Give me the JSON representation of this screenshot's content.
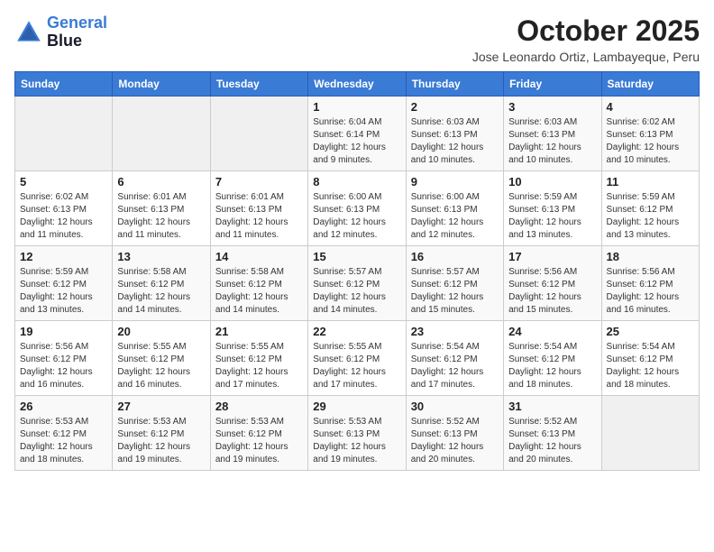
{
  "header": {
    "logo_line1": "General",
    "logo_line2": "Blue",
    "month": "October 2025",
    "location": "Jose Leonardo Ortiz, Lambayeque, Peru"
  },
  "weekdays": [
    "Sunday",
    "Monday",
    "Tuesday",
    "Wednesday",
    "Thursday",
    "Friday",
    "Saturday"
  ],
  "weeks": [
    [
      {
        "day": "",
        "info": ""
      },
      {
        "day": "",
        "info": ""
      },
      {
        "day": "",
        "info": ""
      },
      {
        "day": "1",
        "info": "Sunrise: 6:04 AM\nSunset: 6:14 PM\nDaylight: 12 hours\nand 9 minutes."
      },
      {
        "day": "2",
        "info": "Sunrise: 6:03 AM\nSunset: 6:13 PM\nDaylight: 12 hours\nand 10 minutes."
      },
      {
        "day": "3",
        "info": "Sunrise: 6:03 AM\nSunset: 6:13 PM\nDaylight: 12 hours\nand 10 minutes."
      },
      {
        "day": "4",
        "info": "Sunrise: 6:02 AM\nSunset: 6:13 PM\nDaylight: 12 hours\nand 10 minutes."
      }
    ],
    [
      {
        "day": "5",
        "info": "Sunrise: 6:02 AM\nSunset: 6:13 PM\nDaylight: 12 hours\nand 11 minutes."
      },
      {
        "day": "6",
        "info": "Sunrise: 6:01 AM\nSunset: 6:13 PM\nDaylight: 12 hours\nand 11 minutes."
      },
      {
        "day": "7",
        "info": "Sunrise: 6:01 AM\nSunset: 6:13 PM\nDaylight: 12 hours\nand 11 minutes."
      },
      {
        "day": "8",
        "info": "Sunrise: 6:00 AM\nSunset: 6:13 PM\nDaylight: 12 hours\nand 12 minutes."
      },
      {
        "day": "9",
        "info": "Sunrise: 6:00 AM\nSunset: 6:13 PM\nDaylight: 12 hours\nand 12 minutes."
      },
      {
        "day": "10",
        "info": "Sunrise: 5:59 AM\nSunset: 6:13 PM\nDaylight: 12 hours\nand 13 minutes."
      },
      {
        "day": "11",
        "info": "Sunrise: 5:59 AM\nSunset: 6:12 PM\nDaylight: 12 hours\nand 13 minutes."
      }
    ],
    [
      {
        "day": "12",
        "info": "Sunrise: 5:59 AM\nSunset: 6:12 PM\nDaylight: 12 hours\nand 13 minutes."
      },
      {
        "day": "13",
        "info": "Sunrise: 5:58 AM\nSunset: 6:12 PM\nDaylight: 12 hours\nand 14 minutes."
      },
      {
        "day": "14",
        "info": "Sunrise: 5:58 AM\nSunset: 6:12 PM\nDaylight: 12 hours\nand 14 minutes."
      },
      {
        "day": "15",
        "info": "Sunrise: 5:57 AM\nSunset: 6:12 PM\nDaylight: 12 hours\nand 14 minutes."
      },
      {
        "day": "16",
        "info": "Sunrise: 5:57 AM\nSunset: 6:12 PM\nDaylight: 12 hours\nand 15 minutes."
      },
      {
        "day": "17",
        "info": "Sunrise: 5:56 AM\nSunset: 6:12 PM\nDaylight: 12 hours\nand 15 minutes."
      },
      {
        "day": "18",
        "info": "Sunrise: 5:56 AM\nSunset: 6:12 PM\nDaylight: 12 hours\nand 16 minutes."
      }
    ],
    [
      {
        "day": "19",
        "info": "Sunrise: 5:56 AM\nSunset: 6:12 PM\nDaylight: 12 hours\nand 16 minutes."
      },
      {
        "day": "20",
        "info": "Sunrise: 5:55 AM\nSunset: 6:12 PM\nDaylight: 12 hours\nand 16 minutes."
      },
      {
        "day": "21",
        "info": "Sunrise: 5:55 AM\nSunset: 6:12 PM\nDaylight: 12 hours\nand 17 minutes."
      },
      {
        "day": "22",
        "info": "Sunrise: 5:55 AM\nSunset: 6:12 PM\nDaylight: 12 hours\nand 17 minutes."
      },
      {
        "day": "23",
        "info": "Sunrise: 5:54 AM\nSunset: 6:12 PM\nDaylight: 12 hours\nand 17 minutes."
      },
      {
        "day": "24",
        "info": "Sunrise: 5:54 AM\nSunset: 6:12 PM\nDaylight: 12 hours\nand 18 minutes."
      },
      {
        "day": "25",
        "info": "Sunrise: 5:54 AM\nSunset: 6:12 PM\nDaylight: 12 hours\nand 18 minutes."
      }
    ],
    [
      {
        "day": "26",
        "info": "Sunrise: 5:53 AM\nSunset: 6:12 PM\nDaylight: 12 hours\nand 18 minutes."
      },
      {
        "day": "27",
        "info": "Sunrise: 5:53 AM\nSunset: 6:12 PM\nDaylight: 12 hours\nand 19 minutes."
      },
      {
        "day": "28",
        "info": "Sunrise: 5:53 AM\nSunset: 6:12 PM\nDaylight: 12 hours\nand 19 minutes."
      },
      {
        "day": "29",
        "info": "Sunrise: 5:53 AM\nSunset: 6:13 PM\nDaylight: 12 hours\nand 19 minutes."
      },
      {
        "day": "30",
        "info": "Sunrise: 5:52 AM\nSunset: 6:13 PM\nDaylight: 12 hours\nand 20 minutes."
      },
      {
        "day": "31",
        "info": "Sunrise: 5:52 AM\nSunset: 6:13 PM\nDaylight: 12 hours\nand 20 minutes."
      },
      {
        "day": "",
        "info": ""
      }
    ]
  ]
}
